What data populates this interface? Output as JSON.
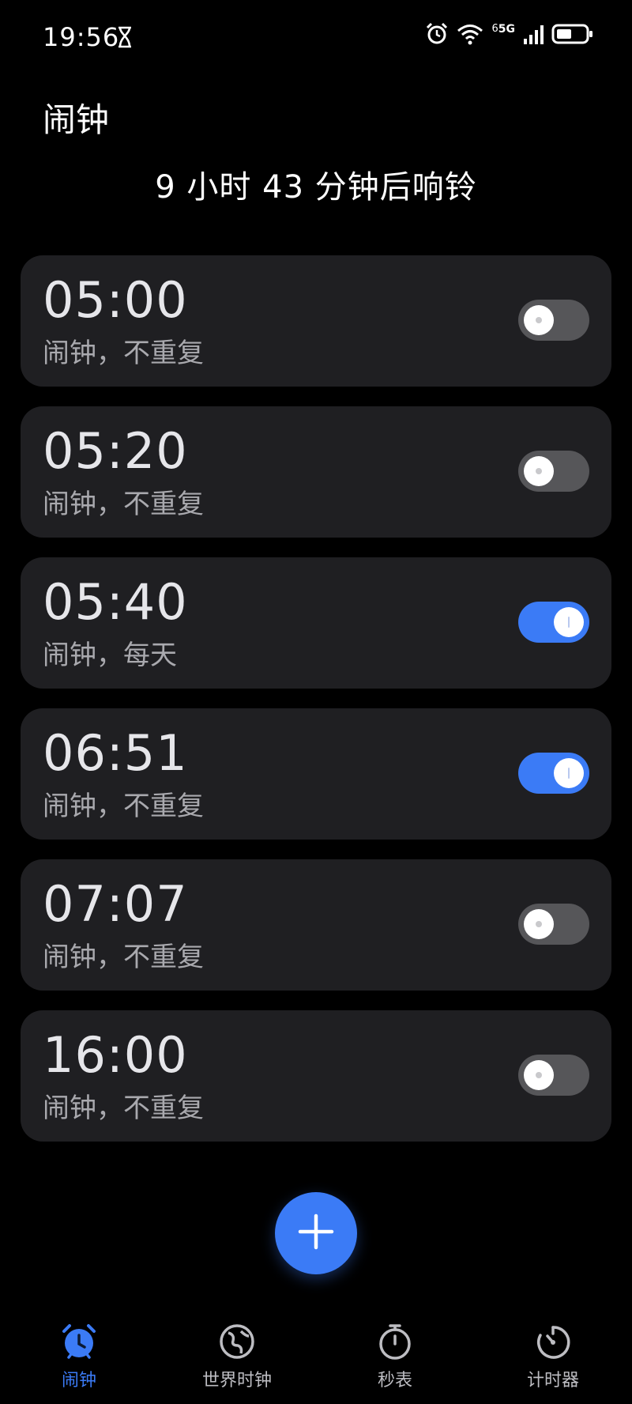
{
  "status_bar": {
    "time": "19:56",
    "network": "5G",
    "sim_indicator": "6",
    "icons": [
      "hourglass-icon",
      "alarm-clock-icon",
      "wifi-icon",
      "signal-icon",
      "battery-icon"
    ]
  },
  "header": {
    "title": "闹钟",
    "next_alarm": "9 小时 43 分钟后响铃"
  },
  "alarms": [
    {
      "time": "05:00",
      "subtitle": "闹钟，不重复",
      "enabled": false
    },
    {
      "time": "05:20",
      "subtitle": "闹钟，不重复",
      "enabled": false
    },
    {
      "time": "05:40",
      "subtitle": "闹钟，每天",
      "enabled": true
    },
    {
      "time": "06:51",
      "subtitle": "闹钟，不重复",
      "enabled": true
    },
    {
      "time": "07:07",
      "subtitle": "闹钟，不重复",
      "enabled": false
    },
    {
      "time": "16:00",
      "subtitle": "闹钟，不重复",
      "enabled": false
    }
  ],
  "fab": {
    "icon": "plus-icon"
  },
  "bottom_nav": {
    "items": [
      {
        "label": "闹钟",
        "icon": "alarm-clock-icon",
        "active": true
      },
      {
        "label": "世界时钟",
        "icon": "globe-icon",
        "active": false
      },
      {
        "label": "秒表",
        "icon": "stopwatch-icon",
        "active": false
      },
      {
        "label": "计时器",
        "icon": "timer-icon",
        "active": false
      }
    ]
  },
  "colors": {
    "background": "#000000",
    "card": "#1f1f22",
    "accent": "#3b7bf6",
    "toggle_off": "#565659"
  }
}
